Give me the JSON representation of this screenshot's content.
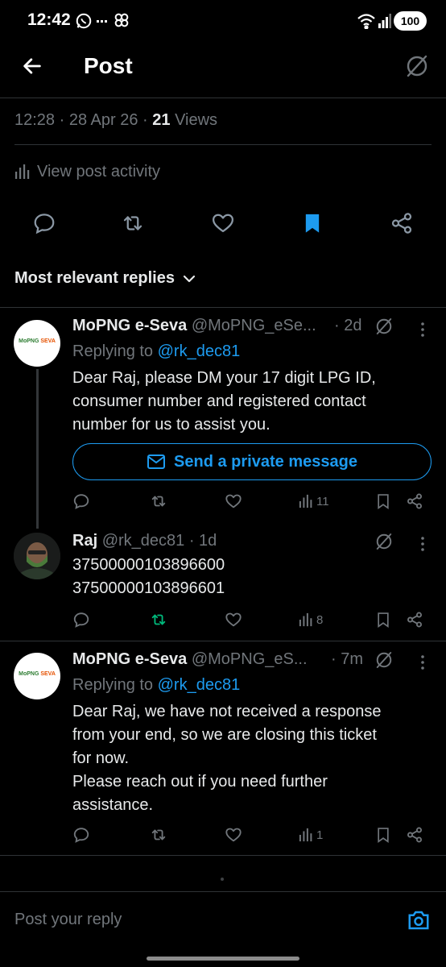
{
  "status_bar": {
    "time": "12:42",
    "battery": "100"
  },
  "header": {
    "title": "Post"
  },
  "meta": {
    "time": "12:28",
    "date": "28 Apr 26",
    "views_count": "21",
    "views_label": "Views"
  },
  "activity": {
    "label": "View post activity"
  },
  "sort": {
    "label": "Most relevant replies"
  },
  "replies": [
    {
      "display_name": "MoPNG e-Seva",
      "handle": "@MoPNG_eSe...",
      "age": "· 2d",
      "replying_prefix": "Replying to",
      "replying_to": "@rk_dec81",
      "text_lines": [
        "Dear Raj, please DM your 17 digit LPG ID,",
        "consumer number and registered contact",
        "number for us to assist you."
      ],
      "dm_button": "Send a private message",
      "views": "11",
      "logo": {
        "left": "MoPNG",
        "right": "SEVA"
      }
    },
    {
      "display_name": "Raj",
      "handle": "@rk_dec81",
      "age": "· 1d",
      "text_lines": [
        "37500000103896600",
        "37500000103896601"
      ],
      "views": "8"
    },
    {
      "display_name": "MoPNG e-Seva",
      "handle": "@MoPNG_eS...",
      "age": "· 7m",
      "replying_prefix": "Replying to",
      "replying_to": "@rk_dec81",
      "text_lines": [
        "Dear Raj, we have not received a response",
        "from your end, so we are closing this ticket",
        "for now.",
        "Please reach out if you need further",
        "assistance."
      ],
      "views": "1",
      "logo": {
        "left": "MoPNG",
        "right": "SEVA"
      }
    }
  ],
  "composer": {
    "placeholder": "Post your reply"
  },
  "colors": {
    "accent": "#1d9bf0",
    "repost_active": "#00ba7c",
    "muted": "#71767b",
    "background": "#000000"
  },
  "icons": [
    "back-arrow-icon",
    "grok-icon",
    "reply-icon",
    "repost-icon",
    "like-icon",
    "bookmark-icon",
    "share-icon",
    "mail-icon",
    "views-icon",
    "camera-icon"
  ]
}
